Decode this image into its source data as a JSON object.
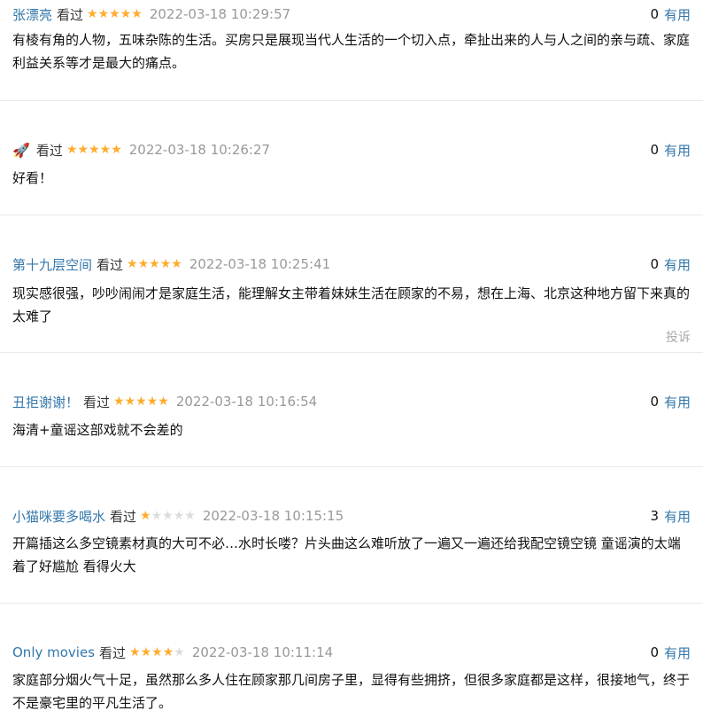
{
  "reviews": [
    {
      "user": "张漂亮",
      "watched": "看过",
      "rating": 5,
      "time": "2022-03-18 10:29:57",
      "useful_count": "0",
      "useful_label": "有用",
      "content": "有棱有角的人物，五味杂陈的生活。买房只是展现当代人生活的一个切入点，牵扯出来的人与人之间的亲与疏、家庭利益关系等才是最大的痛点。"
    },
    {
      "user": "🚀",
      "watched": "看过",
      "rating": 5,
      "time": "2022-03-18 10:26:27",
      "useful_count": "0",
      "useful_label": "有用",
      "content": "好看！"
    },
    {
      "user": "第十九层空间",
      "watched": "看过",
      "rating": 5,
      "time": "2022-03-18 10:25:41",
      "useful_count": "0",
      "useful_label": "有用",
      "content": "现实感很强，吵吵闹闹才是家庭生活，能理解女主带着妹妹生活在顾家的不易，想在上海、北京这种地方留下来真的太难了",
      "report": "投诉"
    },
    {
      "user": "丑拒谢谢！",
      "watched": "看过",
      "rating": 5,
      "time": "2022-03-18 10:16:54",
      "useful_count": "0",
      "useful_label": "有用",
      "content": "海清+童谣这部戏就不会差的"
    },
    {
      "user": "小猫咪要多喝水",
      "watched": "看过",
      "rating": 1,
      "time": "2022-03-18 10:15:15",
      "useful_count": "3",
      "useful_label": "有用",
      "content": "开篇插这么多空镜素材真的大可不必…水时长喽？片头曲这么难听放了一遍又一遍还给我配空镜空镜 童谣演的太端着了好尴尬 看得火大"
    },
    {
      "user": "Only movies",
      "watched": "看过",
      "rating": 4,
      "time": "2022-03-18 10:11:14",
      "useful_count": "0",
      "useful_label": "有用",
      "content": "家庭部分烟火气十足，虽然那么多人住在顾家那几间房子里，显得有些拥挤，但很多家庭都是这样，很接地气，终于不是豪宅里的平凡生活了。"
    }
  ],
  "colors": {
    "link": "#3377aa",
    "star_on": "#ffac2d",
    "star_off": "#dcdcdc",
    "time": "#999999"
  },
  "icons": {
    "star": "star-icon",
    "rocket": "rocket-icon"
  }
}
